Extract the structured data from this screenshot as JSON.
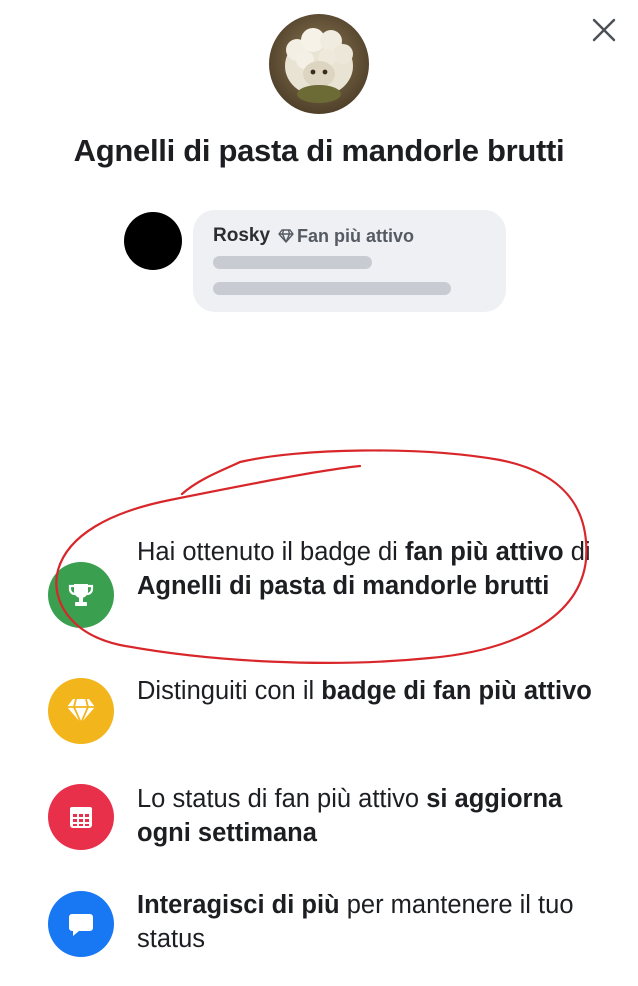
{
  "page": {
    "title": "Agnelli di pasta di mandorle brutti"
  },
  "preview": {
    "user_name": "Rosky",
    "badge_label": "Fan più attivo"
  },
  "items": [
    {
      "icon": "trophy-icon",
      "color": "#3a9f4f",
      "parts": [
        "Hai ottenuto il badge di ",
        "fan più attivo",
        " di ",
        "Agnelli di pasta di mandorle brutti"
      ]
    },
    {
      "icon": "diamond-icon",
      "color": "#f2b51b",
      "parts": [
        "Distinguiti con il ",
        "badge di fan più attivo"
      ]
    },
    {
      "icon": "calendar-icon",
      "color": "#e8304b",
      "parts": [
        "Lo status di fan più attivo ",
        "si aggiorna ogni settimana"
      ]
    },
    {
      "icon": "chat-bubble-icon",
      "color": "#1877f2",
      "parts": [
        "Interagisci di più",
        " per mantenere il tuo status"
      ]
    }
  ],
  "annotation_color": "#d8262a"
}
